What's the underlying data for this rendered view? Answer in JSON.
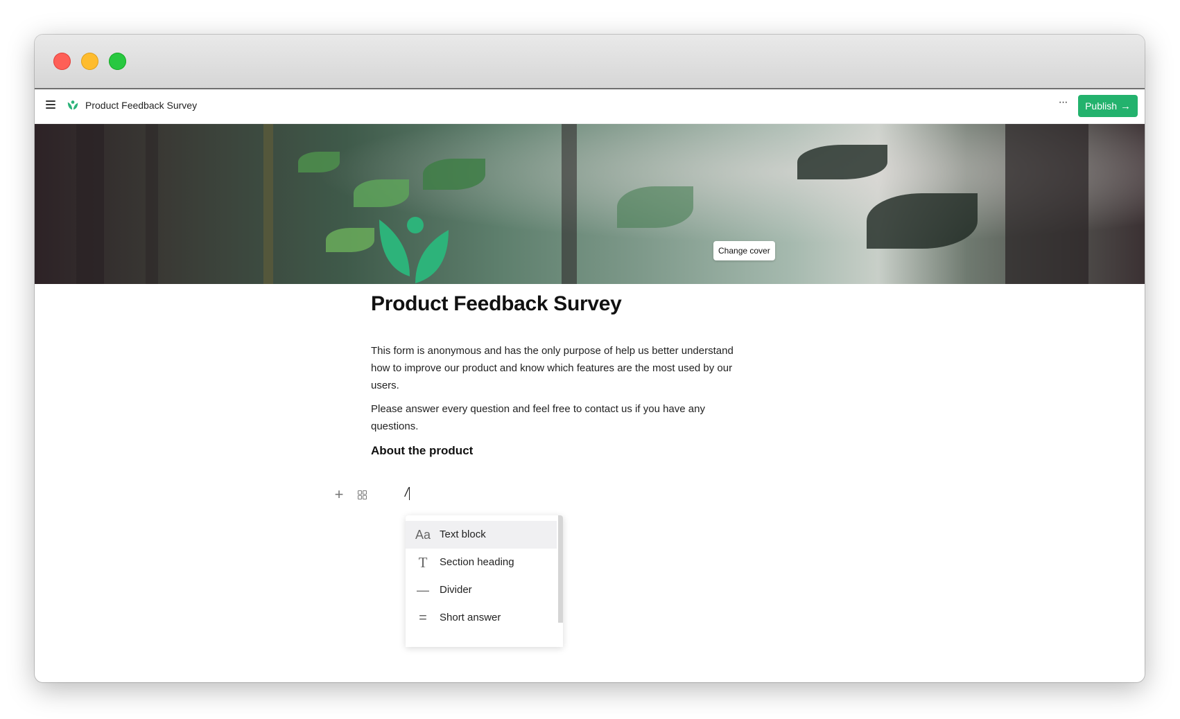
{
  "app": {
    "doc_title": "Product Feedback Survey",
    "publish_label": "Publish",
    "more_label": "···"
  },
  "cover": {
    "change_cover_label": "Change cover"
  },
  "page": {
    "title": "Product Feedback Survey",
    "paragraph_1": "This form is anonymous and has the only purpose of help us better understand how to improve our product and know which features are the most used by our users.",
    "paragraph_2": "Please answer every question and feel free to contact us if you have any questions.",
    "section_heading": "About the product",
    "input_value": "/"
  },
  "block_menu": {
    "items": [
      {
        "icon": "text-block-icon",
        "glyph": "Aa",
        "label": "Text block"
      },
      {
        "icon": "section-heading-icon",
        "glyph": "T",
        "label": "Section heading"
      },
      {
        "icon": "divider-icon",
        "glyph": "—",
        "label": "Divider"
      },
      {
        "icon": "short-answer-icon",
        "glyph": "=",
        "label": "Short answer"
      }
    ]
  },
  "colors": {
    "accent": "#23b26d",
    "logo_green": "#2db37a"
  }
}
